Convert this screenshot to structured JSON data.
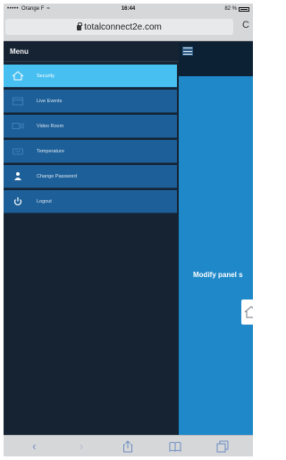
{
  "status_bar": {
    "carrier": "Orange F",
    "time": "16:44",
    "battery": "82 %"
  },
  "browser": {
    "url": "totalconnect2e.com",
    "reload_glyph": "C"
  },
  "sidebar": {
    "title": "Menu",
    "items": [
      {
        "label": "Security",
        "icon": "home-icon",
        "active": true
      },
      {
        "label": "Live Events",
        "icon": "calendar-icon",
        "active": false
      },
      {
        "label": "Video Room",
        "icon": "video-camera-icon",
        "active": false
      },
      {
        "label": "Temperature",
        "icon": "thermostat-icon",
        "active": false
      },
      {
        "label": "Change Password",
        "icon": "person-icon",
        "active": false
      },
      {
        "label": "Logout",
        "icon": "power-icon",
        "active": false
      }
    ]
  },
  "main": {
    "heading": "Modify panel s"
  },
  "colors": {
    "sidebar_bg": "#162332",
    "menu_item_bg": "#1d5f98",
    "active_item_bg": "#47bff0",
    "main_bg": "#1e88c9",
    "browser_chrome": "#d6d7d9"
  }
}
